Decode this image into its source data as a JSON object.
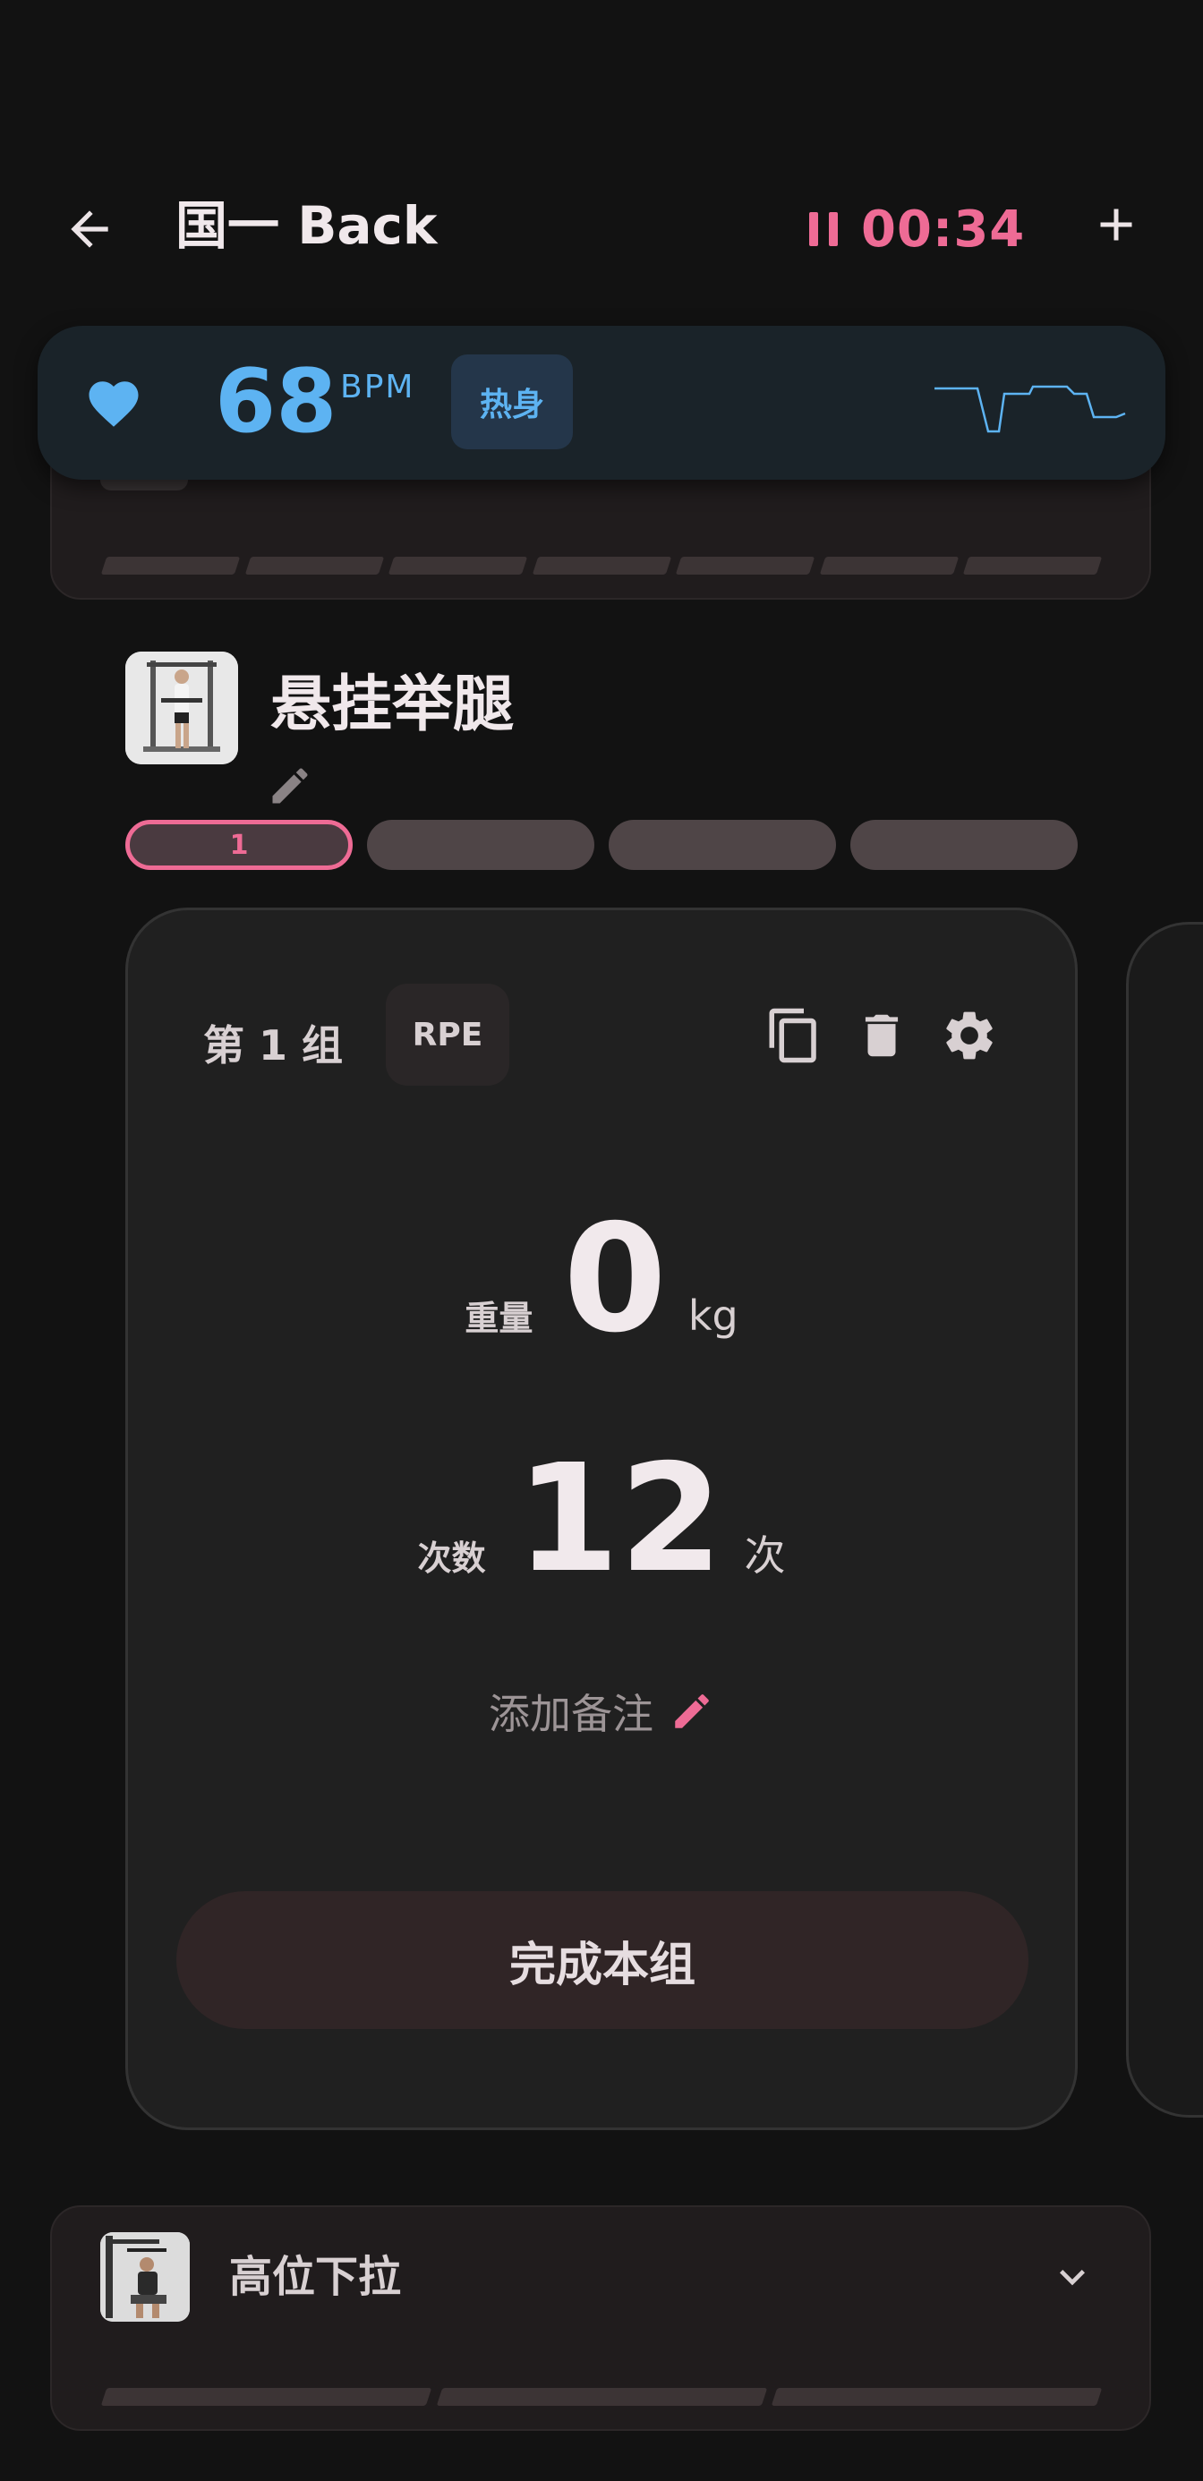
{
  "header": {
    "title": "国一 Back",
    "timer": "00:34"
  },
  "heart_rate": {
    "value": "68",
    "unit": "BPM",
    "zone": "热身",
    "accent_color": "#5db3f2"
  },
  "previous_exercise": {
    "set_count": 7
  },
  "current_exercise": {
    "name": "悬挂举腿",
    "set_tabs": [
      {
        "label": "1",
        "active": true
      },
      {
        "label": "",
        "active": false
      },
      {
        "label": "",
        "active": false
      },
      {
        "label": "",
        "active": false
      }
    ]
  },
  "set_card": {
    "set_label": "第 1 组",
    "rpe_label": "RPE",
    "weight_label": "重量",
    "weight_value": "0",
    "weight_unit": "kg",
    "reps_label": "次数",
    "reps_value": "12",
    "reps_unit": "次",
    "note_placeholder": "添加备注",
    "complete_label": "完成本组"
  },
  "next_exercise": {
    "name": "高位下拉",
    "set_count": 3
  },
  "colors": {
    "accent": "#ee6b95",
    "background": "#121212",
    "card": "#202020"
  }
}
